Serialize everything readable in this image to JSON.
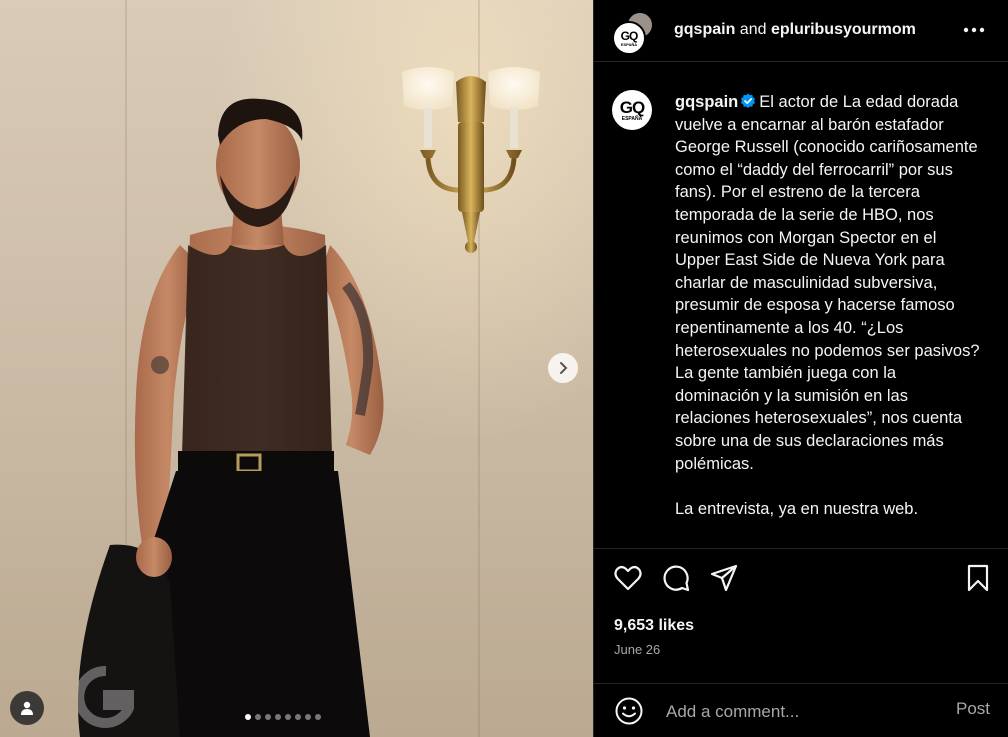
{
  "header": {
    "username_primary": "gqspain",
    "conjunction": "and",
    "username_collab": "epluribusyourmom",
    "more_icon": "more-horizontal-icon"
  },
  "brand": {
    "gq_mark": "GQ",
    "gq_sub": "ESPAÑA"
  },
  "caption": {
    "author": "gqspain",
    "verified": true,
    "text": "El actor de La edad dorada vuelve a encarnar al barón estafador George Russell (conocido cariñosamente como el “daddy del ferrocarril” por sus fans). Por el estreno de la tercera temporada de la serie de HBO, nos reunimos con Morgan Spector en el Upper East Side de Nueva York para charlar de masculinidad subversiva, presumir de esposa y hacerse famoso repentinamente a los 40. “¿Los heterosexuales no podemos ser pasivos? La gente también juega con la dominación y la sumisión en las relaciones heterosexuales”, nos cuenta sobre una de sus declaraciones más polémicas.\n\nLa entrevista, ya en nuestra web."
  },
  "media": {
    "carousel_total": 8,
    "carousel_active": 1,
    "watermark": "GQ",
    "icons": {
      "next": "chevron-right-icon",
      "tags": "user-tag-icon"
    }
  },
  "actions": {
    "like_icon": "heart-icon",
    "comment_icon": "comment-icon",
    "share_icon": "share-icon",
    "save_icon": "bookmark-icon"
  },
  "stats": {
    "likes": "9,653 likes",
    "date": "June 26"
  },
  "comment": {
    "placeholder": "Add a comment...",
    "post_label": "Post",
    "emoji_icon": "emoji-icon"
  },
  "colors": {
    "background": "#000000",
    "text": "#f5f5f5",
    "muted": "#a8a8a8",
    "verified": "#0095f6",
    "divider": "#262626"
  }
}
